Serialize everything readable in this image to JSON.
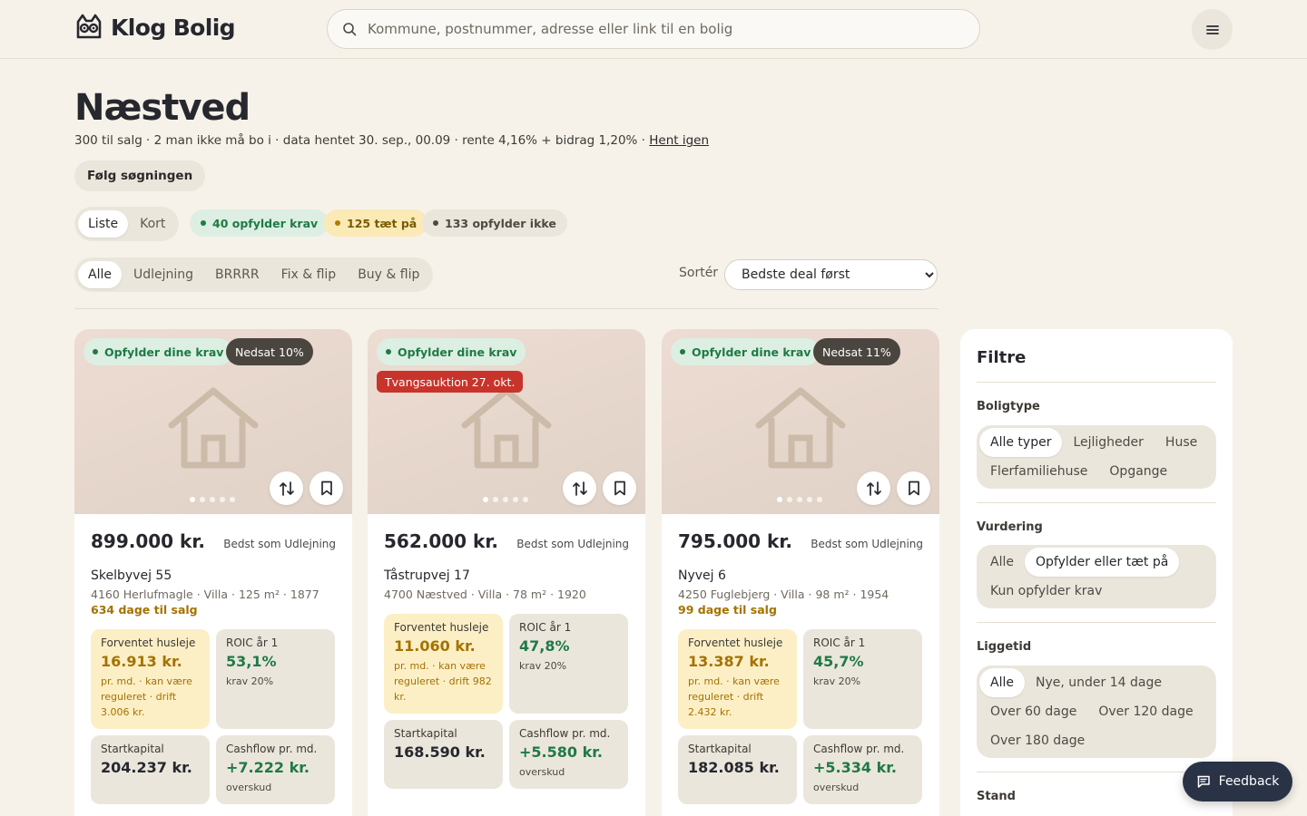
{
  "app": {
    "name": "Klog Bolig"
  },
  "search": {
    "placeholder": "Kommune, postnummer, adresse eller link til en bolig"
  },
  "page": {
    "title": "Næstved",
    "meta": "300 til salg · 2 man ikke må bo i · data hentet 30. sep., 00.09 · rente 4,16% + bidrag 1,20% · ",
    "refresh_label": "Hent igen",
    "follow_label": "Følg søgningen"
  },
  "view_toggle": {
    "list": "Liste",
    "map": "Kort",
    "active": "Liste"
  },
  "status_pills": {
    "meets": "40 opfylder krav",
    "close": "125 tæt på",
    "not_meets": "133 opfylder ikke"
  },
  "strategy_tabs": [
    "Alle",
    "Udlejning",
    "BRRRR",
    "Fix & flip",
    "Buy & flip"
  ],
  "sort": {
    "label": "Sortér",
    "selected": "Bedste deal først"
  },
  "cards": [
    {
      "badge_ok": "Opfylder dine krav",
      "badge_sale": "Nedsat 10%",
      "badge_auction": "",
      "price": "899.000 kr.",
      "best": "Bedst som Udlejning",
      "address": "Skelbyvej 55",
      "sub": "4160 Herlufmagle · Villa · 125 m² · 1877",
      "days": "634 dage til salg",
      "rent_label": "Forventet husleje",
      "rent_value": "16.913 kr.",
      "rent_note": "pr. md. · kan være reguleret · drift 3.006 kr.",
      "roic_label": "ROIC år 1",
      "roic_value": "53,1%",
      "roic_note": "krav 20%",
      "capital_label": "Startkapital",
      "capital_value": "204.237 kr.",
      "cash_label": "Cashflow pr. md.",
      "cash_value": "+7.222 kr.",
      "cash_note": "overskud"
    },
    {
      "badge_ok": "Opfylder dine krav",
      "badge_sale": "",
      "badge_auction": "Tvangsauktion 27. okt.",
      "price": "562.000 kr.",
      "best": "Bedst som Udlejning",
      "address": "Tåstrupvej 17",
      "sub": "4700 Næstved · Villa · 78 m² · 1920",
      "days": "",
      "rent_label": "Forventet husleje",
      "rent_value": "11.060 kr.",
      "rent_note": "pr. md. · kan være reguleret · drift 982 kr.",
      "roic_label": "ROIC år 1",
      "roic_value": "47,8%",
      "roic_note": "krav 20%",
      "capital_label": "Startkapital",
      "capital_value": "168.590 kr.",
      "cash_label": "Cashflow pr. md.",
      "cash_value": "+5.580 kr.",
      "cash_note": "overskud"
    },
    {
      "badge_ok": "Opfylder dine krav",
      "badge_sale": "Nedsat 11%",
      "badge_auction": "",
      "price": "795.000 kr.",
      "best": "Bedst som Udlejning",
      "address": "Nyvej 6",
      "sub": "4250 Fuglebjerg · Villa · 98 m² · 1954",
      "days": "99 dage til salg",
      "rent_label": "Forventet husleje",
      "rent_value": "13.387 kr.",
      "rent_note": "pr. md. · kan være reguleret · drift 2.432 kr.",
      "roic_label": "ROIC år 1",
      "roic_value": "45,7%",
      "roic_note": "krav 20%",
      "capital_label": "Startkapital",
      "capital_value": "182.085 kr.",
      "cash_label": "Cashflow pr. md.",
      "cash_value": "+5.334 kr.",
      "cash_note": "overskud"
    }
  ],
  "filters": {
    "title": "Filtre",
    "boligtype": {
      "label": "Boligtype",
      "options": [
        "Alle typer",
        "Lejligheder",
        "Huse",
        "Flerfamiliehuse",
        "Opgange"
      ]
    },
    "vurdering": {
      "label": "Vurdering",
      "options": [
        "Alle",
        "Opfylder eller tæt på",
        "Kun opfylder krav"
      ]
    },
    "liggetid": {
      "label": "Liggetid",
      "options": [
        "Alle",
        "Nye, under 14 dage",
        "Over 60 dage",
        "Over 120 dage",
        "Over 180 dage"
      ]
    },
    "stand": {
      "label": "Stand"
    }
  },
  "feedback": {
    "label": "Feedback"
  },
  "colors": {
    "accent_green": "#1f7a45",
    "accent_gold": "#a47200",
    "auction_red": "#c8342b",
    "dark": "#2a3346"
  }
}
